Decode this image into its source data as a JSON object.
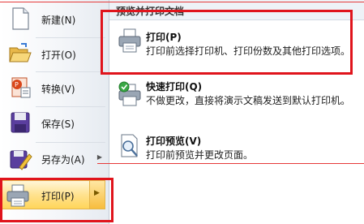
{
  "menu": {
    "items": [
      {
        "label": "新建(N)",
        "icon": "new-document-icon"
      },
      {
        "label": "打开(O)",
        "icon": "open-folder-icon"
      },
      {
        "label": "转换(V)",
        "icon": "convert-icon"
      },
      {
        "label": "保存(S)",
        "icon": "save-disk-icon"
      },
      {
        "label": "另存为(A)",
        "icon": "save-as-icon",
        "submenu_glyph": "▶"
      },
      {
        "label": "打印(P)",
        "icon": "printer-icon",
        "submenu_glyph": "▶",
        "active": true
      }
    ]
  },
  "submenu": {
    "header": "预览并打印文档",
    "options": [
      {
        "title": "打印(P)",
        "desc": "打印前选择打印机、打印份数及其他打印选项。",
        "icon": "printer-icon"
      },
      {
        "title": "快速打印(Q)",
        "desc": "不做更改，直接将演示文稿发送到默认打印机。",
        "icon": "quick-print-icon"
      },
      {
        "title": "打印预览(V)",
        "desc": "打印前预览并更改页面。",
        "icon": "print-preview-icon"
      }
    ]
  },
  "colors": {
    "highlight_box": "#e0141c",
    "active_gradient": "#ffd55a"
  }
}
